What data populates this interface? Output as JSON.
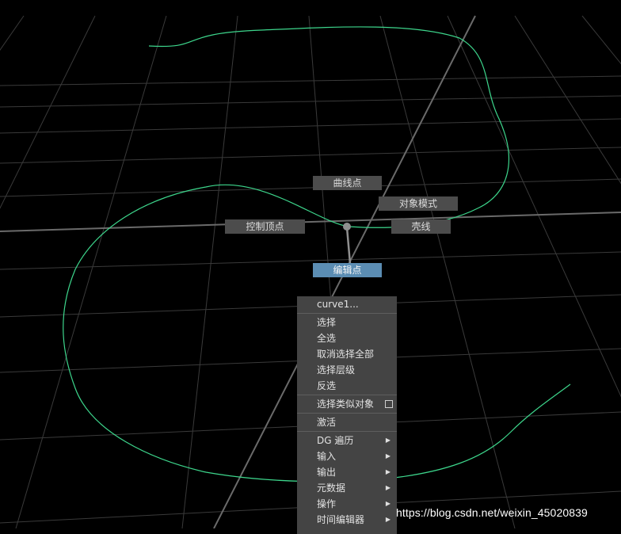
{
  "colors": {
    "background": "#000000",
    "grid": "#3a3a3a",
    "curve": "#3dd68c",
    "active_label": "#5b8db3",
    "menu_bg": "#444444"
  },
  "marking_menu": {
    "north": "曲线点",
    "north_east": "对象模式",
    "east": "壳线",
    "west": "控制顶点",
    "south": "编辑点"
  },
  "context_menu": {
    "title": "curve1...",
    "items": [
      {
        "label": "选择"
      },
      {
        "label": "全选"
      },
      {
        "label": "取消选择全部"
      },
      {
        "label": "选择层级"
      },
      {
        "label": "反选"
      },
      {
        "label": "选择类似对象",
        "option_box": "option-box-icon"
      },
      {
        "label": "激活"
      },
      {
        "label": "DG 遍历",
        "submenu": "submenu-arrow-icon"
      },
      {
        "label": "输入",
        "submenu": "submenu-arrow-icon"
      },
      {
        "label": "输出",
        "submenu": "submenu-arrow-icon"
      },
      {
        "label": "元数据",
        "submenu": "submenu-arrow-icon"
      },
      {
        "label": "操作",
        "submenu": "submenu-arrow-icon"
      },
      {
        "label": "时间编辑器",
        "submenu": "submenu-arrow-icon"
      }
    ]
  },
  "watermark": "https://blog.csdn.net/weixin_45020839"
}
